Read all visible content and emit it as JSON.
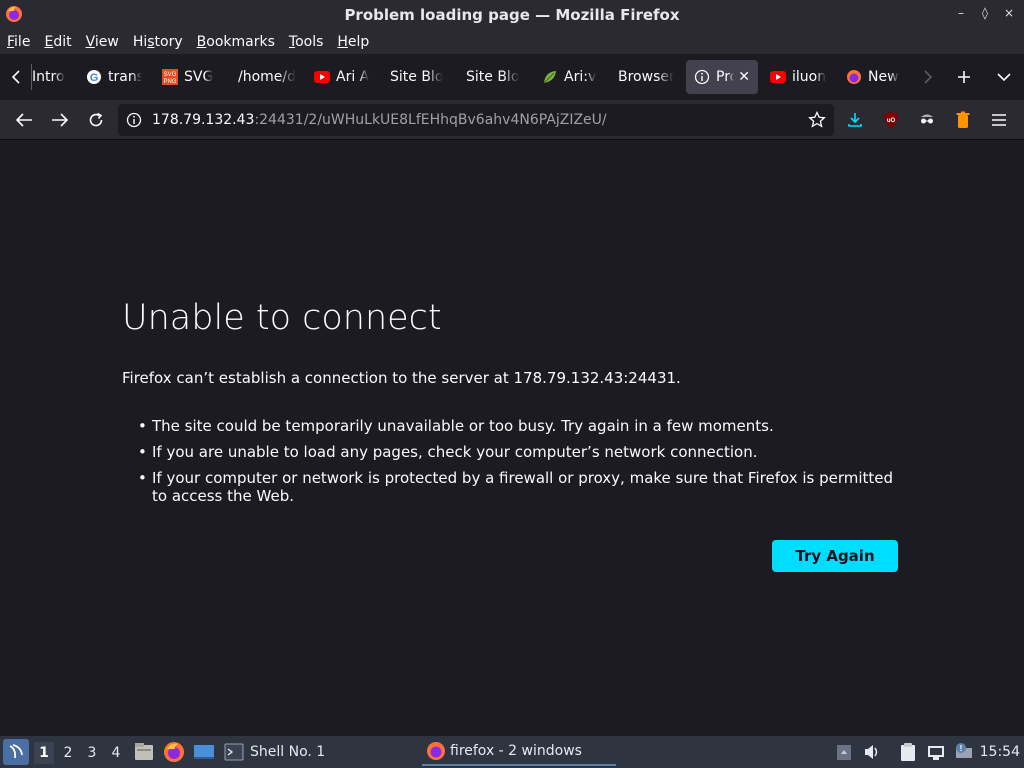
{
  "window": {
    "title": "Problem loading page — Mozilla Firefox",
    "controls": [
      "–",
      "◊",
      "×"
    ]
  },
  "menubar": {
    "items": [
      {
        "label": "File",
        "accel": "F"
      },
      {
        "label": "Edit",
        "accel": "E"
      },
      {
        "label": "View",
        "accel": "V"
      },
      {
        "label": "History",
        "accel": "s"
      },
      {
        "label": "Bookmarks",
        "accel": "B"
      },
      {
        "label": "Tools",
        "accel": "T"
      },
      {
        "label": "Help",
        "accel": "H"
      }
    ]
  },
  "tabs": [
    {
      "label": "Intro",
      "icon": "none"
    },
    {
      "label": "trans",
      "icon": "google-icon"
    },
    {
      "label": "SVG",
      "icon": "svg-png-icon"
    },
    {
      "label": "/home/d",
      "icon": "none"
    },
    {
      "label": "Ari A",
      "icon": "youtube-icon"
    },
    {
      "label": "Site Blo",
      "icon": "none"
    },
    {
      "label": "Site Blo",
      "icon": "none"
    },
    {
      "label": "Ari:v",
      "icon": "leaf-icon"
    },
    {
      "label": "Browser",
      "icon": "none"
    },
    {
      "label": "Pro",
      "icon": "info-icon",
      "active": true
    },
    {
      "label": "iluon",
      "icon": "youtube-icon"
    },
    {
      "label": "New",
      "icon": "firefox-icon"
    }
  ],
  "navbar": {
    "url_host": "178.79.132.43",
    "url_rest": ":24431/2/uWHuLkUE8LfEHhqBv6ahv4N6PAjZIZeU/"
  },
  "error": {
    "title": "Unable to connect",
    "description": "Firefox can’t establish a connection to the server at 178.79.132.43:24431.",
    "bullets": [
      "The site could be temporarily unavailable or too busy. Try again in a few moments.",
      "If you are unable to load any pages, check your computer’s network connection.",
      "If your computer or network is protected by a firewall or proxy, make sure that Firefox is permitted to access the Web."
    ],
    "try_again_label": "Try Again"
  },
  "taskbar": {
    "workspaces": [
      "1",
      "2",
      "3",
      "4"
    ],
    "active_workspace": "1",
    "tasks": [
      {
        "label": "Shell No. 1"
      },
      {
        "label": "firefox - 2 windows"
      }
    ],
    "clock": "15:54"
  },
  "colors": {
    "accent": "#00ddff",
    "page_bg": "#1c1b22",
    "chrome_bg": "#2b2a33"
  }
}
